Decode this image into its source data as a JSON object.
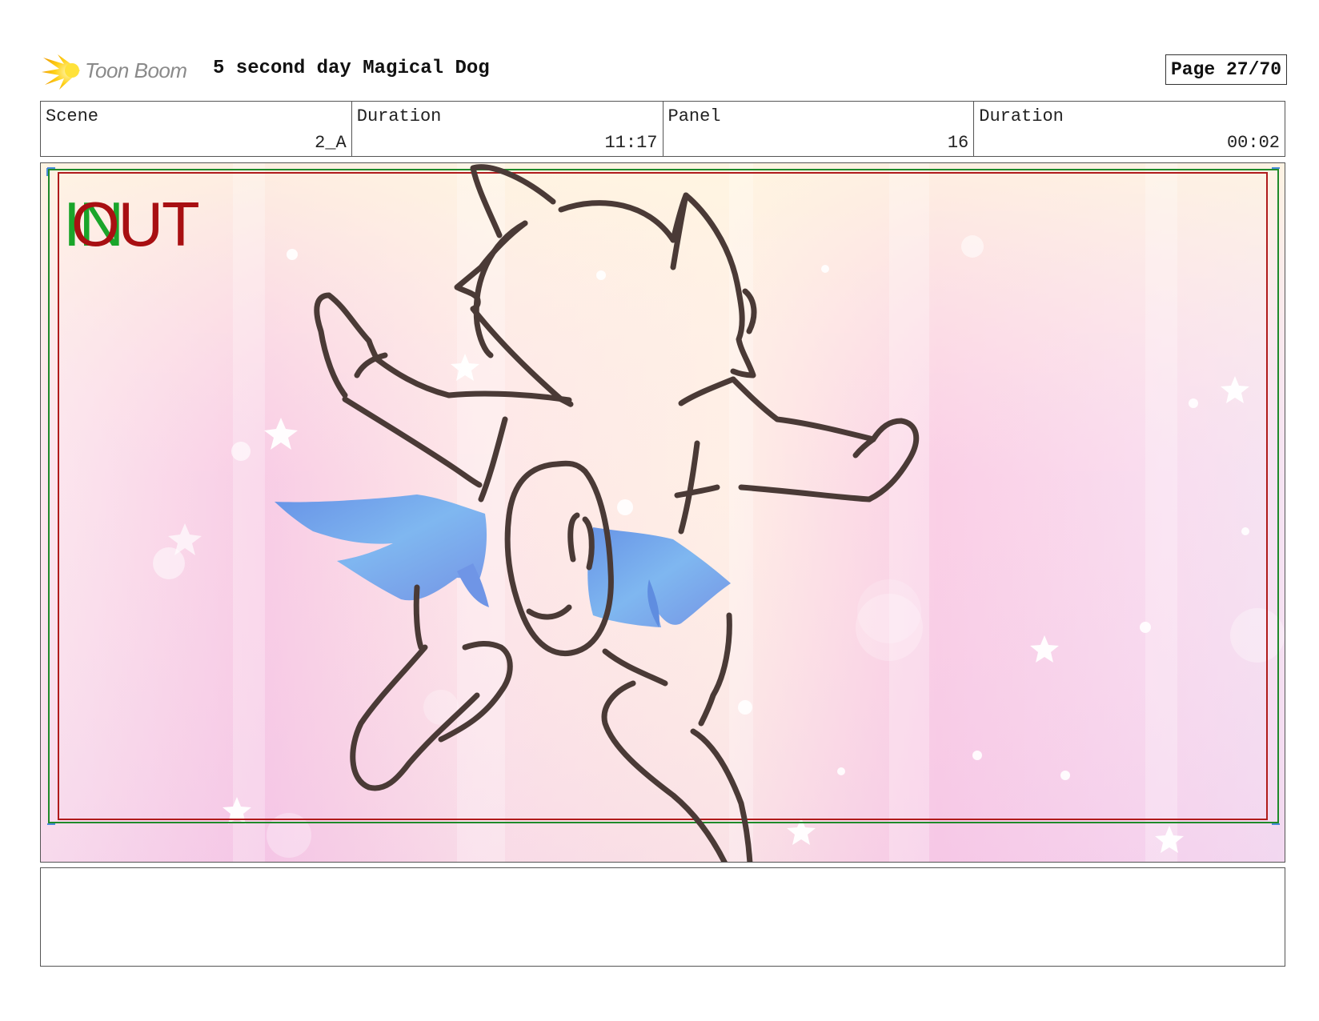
{
  "header": {
    "logo_text": "Toon Boom",
    "project_title": "5 second day Magical Dog",
    "page_label": "Page 27/70"
  },
  "info": {
    "scene_label": "Scene",
    "scene_value": "2_A",
    "scene_duration_label": "Duration",
    "scene_duration_value": "11:17",
    "panel_label": "Panel",
    "panel_value": "16",
    "panel_duration_label": "Duration",
    "panel_duration_value": "00:02"
  },
  "panel": {
    "in_marker": "IN",
    "out_marker": "OUT"
  },
  "colors": {
    "logo_flame": "#f5b800",
    "in_marker": "#1aa52a",
    "out_marker": "#a80f12",
    "sketch_line": "#4a3a36",
    "wings": "#6ea0ea",
    "background_pink": "#f6bfe0",
    "background_cream": "#fff3de"
  },
  "notes": {
    "text": ""
  }
}
